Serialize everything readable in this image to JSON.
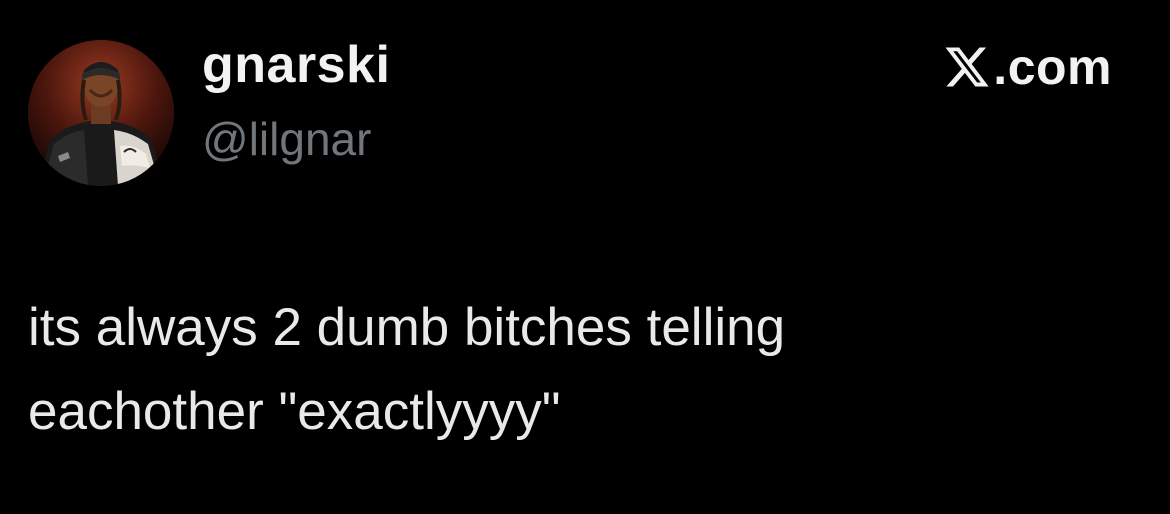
{
  "author": {
    "display_name": "gnarski",
    "handle": "@lilgnar"
  },
  "brand": {
    "icon": "x-logo-icon",
    "domain": ".com"
  },
  "tweet": {
    "text": "its always 2 dumb bitches telling\neachother \"exactlyyyy\""
  },
  "colors": {
    "background": "#000000",
    "primary_text": "#e7e9ea",
    "secondary_text": "#71767b"
  }
}
